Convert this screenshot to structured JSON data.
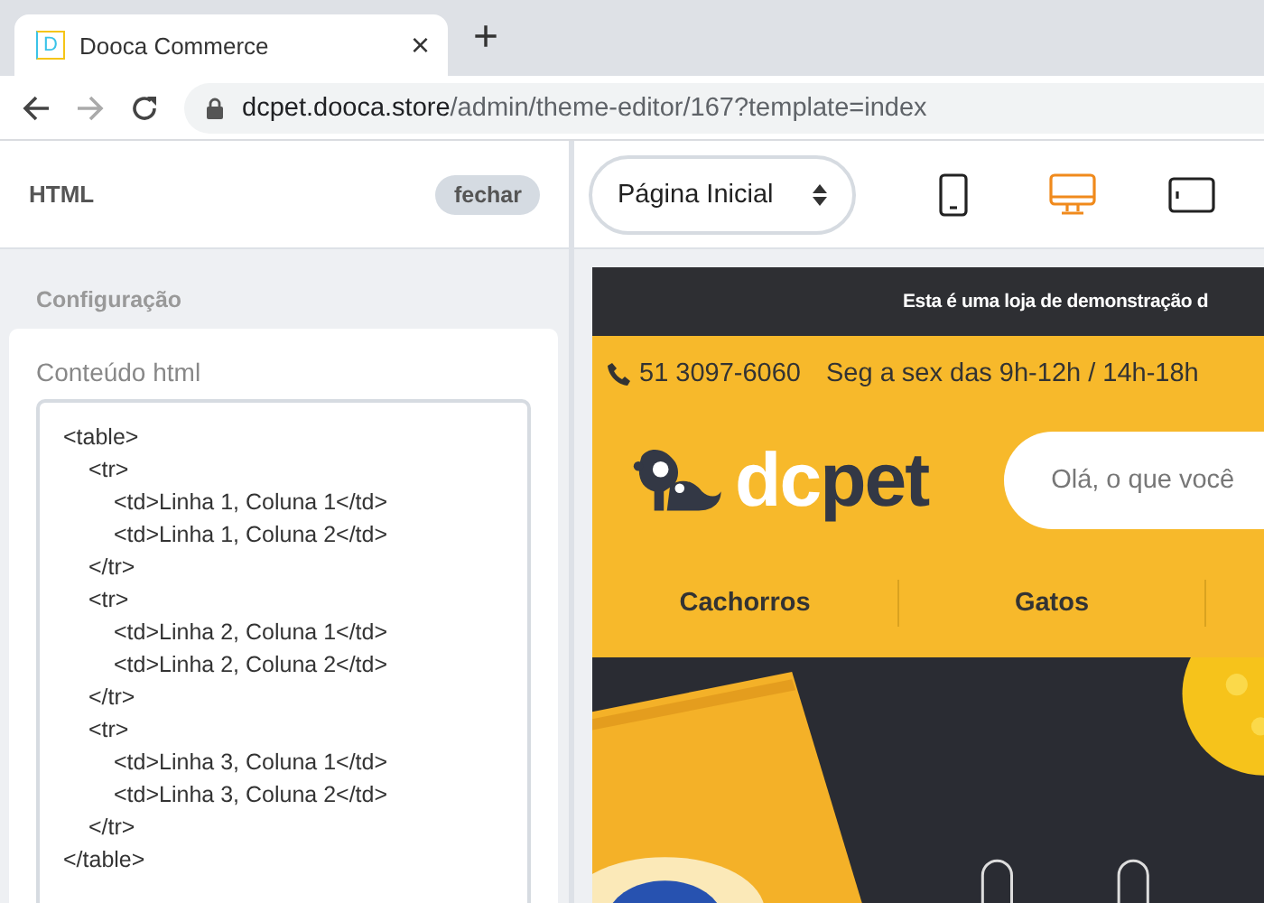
{
  "browser": {
    "tab": {
      "title": "Dooca Commerce",
      "favicon": "D",
      "close": "×"
    },
    "new_tab": "+",
    "url": {
      "host": "dcpet.dooca.store",
      "path": "/admin/theme-editor/167?template=index"
    }
  },
  "panel": {
    "title": "HTML",
    "close_button": "fechar",
    "section": "Configuração",
    "field_label": "Conteúdo html",
    "code": [
      {
        "open": "<table>",
        "close": "</table>",
        "children": [
          {
            "open": "<tr>",
            "close": "</tr>",
            "children": [
              {
                "text": "<td>Linha 1, Coluna 1</td>"
              },
              {
                "text": "<td>Linha 1, Coluna 2</td>"
              }
            ]
          },
          {
            "open": "<tr>",
            "close": "</tr>",
            "children": [
              {
                "text": "<td>Linha 2, Coluna 1</td>"
              },
              {
                "text": "<td>Linha 2, Coluna 2</td>"
              }
            ]
          },
          {
            "open": "<tr>",
            "close": "</tr>",
            "children": [
              {
                "text": "<td>Linha 3, Coluna 1</td>"
              },
              {
                "text": "<td>Linha 3, Coluna 2</td>"
              }
            ]
          }
        ]
      }
    ]
  },
  "toolbar": {
    "page_select": "Página Inicial",
    "devices": [
      {
        "kind": "mobile",
        "selected": false
      },
      {
        "kind": "desktop",
        "selected": true
      },
      {
        "kind": "tablet",
        "selected": false
      }
    ]
  },
  "preview": {
    "announcement": "Esta é uma loja de demonstração d",
    "phone": "51 3097-6060",
    "hours": "Seg a sex das 9h-12h / 14h-18h",
    "logo": [
      "dc",
      "pet"
    ],
    "search_placeholder": "Olá, o que você",
    "menu": [
      "Cachorros",
      "Gatos"
    ],
    "banner": {
      "kind": "picture"
    }
  }
}
